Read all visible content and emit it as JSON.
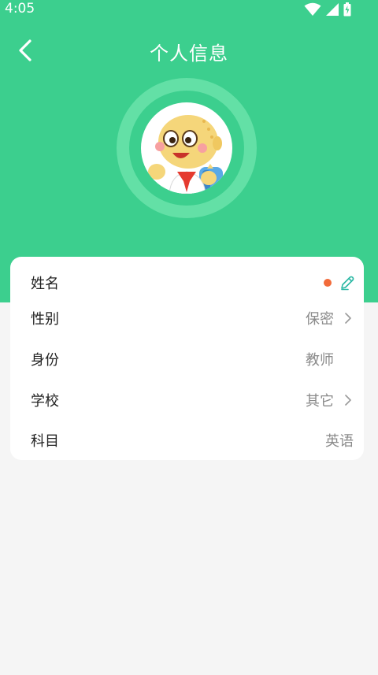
{
  "status_bar": {
    "time": "4:05"
  },
  "nav": {
    "title": "个人信息",
    "back_icon": "chevron-left-icon"
  },
  "profile": {
    "rows": [
      {
        "label": "姓名",
        "value": "",
        "has_chevron": false,
        "has_edit": true
      },
      {
        "label": "性别",
        "value": "保密",
        "has_chevron": true
      },
      {
        "label": "身份",
        "value": "教师",
        "has_chevron": false
      },
      {
        "label": "学校",
        "value": "其它",
        "has_chevron": true
      },
      {
        "label": "科目",
        "value": "英语",
        "has_chevron": false
      }
    ]
  },
  "colors": {
    "header_green": "#3ccf8e",
    "ring_light": "#63e0a6",
    "indicator_dot": "#f26b3a",
    "edit_icon": "#2bb8a4"
  }
}
